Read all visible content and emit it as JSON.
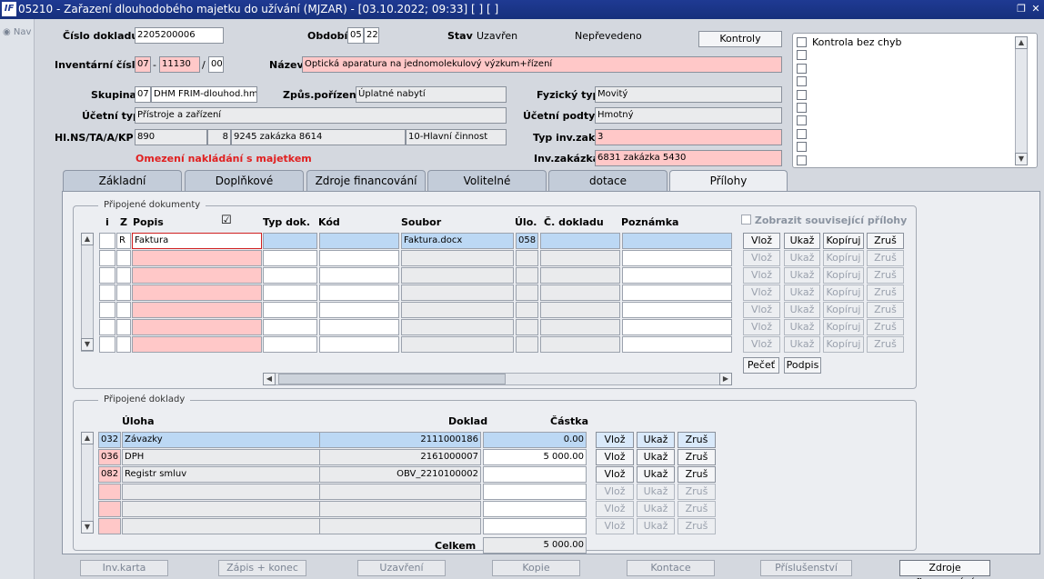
{
  "window": {
    "logo": "IF",
    "title": "05210 - Zařazení dlouhodobého majetku do užívání (MJZAR) - [03.10.2022; 09:33]  [ ]  [ ]"
  },
  "nav": {
    "label": "Nav"
  },
  "header": {
    "cislo_dokladu": {
      "label": "Číslo dokladu",
      "value": "2205200006"
    },
    "obdobi": {
      "label": "Období",
      "month": "05",
      "year": "22"
    },
    "stav": {
      "label": "Stav",
      "value": "Uzavřen",
      "transfer": "Nepřevedeno"
    },
    "kontroly_btn": "Kontroly",
    "inv_cislo": {
      "label": "Inventární číslo",
      "a": "07",
      "sep1": "-",
      "b": "11130",
      "sep2": "/",
      "c": "00"
    },
    "nazev": {
      "label": "Název",
      "value": "Optická aparatura na jednomolekulový výzkum+řízení"
    },
    "skupina": {
      "label": "Skupina",
      "code": "07",
      "value": "DHM FRIM-dlouhod.hmo"
    },
    "zpusob": {
      "label": "Způs.pořízení",
      "value": "Úplatné nabytí"
    },
    "fyzicky": {
      "label": "Fyzický typ",
      "value": "Movitý"
    },
    "ucetni_typ": {
      "label": "Účetní typ",
      "value": "Přístroje a zařízení"
    },
    "ucetni_podtyp": {
      "label": "Účetní podtyp",
      "value": "Hmotný"
    },
    "hlns": {
      "label": "Hl.NS/TA/A/KP",
      "ns": "890",
      "ta": "8",
      "a": "9245 zakázka 8614",
      "kp": "10-Hlavní činnost"
    },
    "typ_inv": {
      "label": "Typ inv.zak.",
      "value": "3"
    },
    "omezeni": "Omezení nakládání s majetkem",
    "inv_zakazka": {
      "label": "Inv.zakázka",
      "value": "6831 zakázka 5430"
    }
  },
  "checks": {
    "items": [
      "Kontrola bez chyb",
      "",
      "",
      "",
      "",
      "",
      "",
      "",
      "",
      ""
    ]
  },
  "tabs": [
    "Základní",
    "Doplňkové",
    "Zdroje financování",
    "Volitelné",
    "dotace",
    "Přílohy"
  ],
  "docs": {
    "title": "Připojené dokumenty",
    "headers": {
      "i": "i",
      "z": "Z",
      "popis": "Popis",
      "typ": "Typ dok.",
      "kod": "Kód",
      "soubor": "Soubor",
      "ulo": "Úlo.",
      "cdok": "Č. dokladu",
      "pozn": "Poznámka"
    },
    "rows": [
      {
        "i": "",
        "z": "R",
        "popis": "Faktura",
        "typ": "",
        "kod": "",
        "soubor": "Faktura.docx",
        "ulo": "058",
        "cdok": "",
        "pozn": ""
      },
      {
        "i": "",
        "z": "",
        "popis": "",
        "typ": "",
        "kod": "",
        "soubor": "",
        "ulo": "",
        "cdok": "",
        "pozn": ""
      },
      {
        "i": "",
        "z": "",
        "popis": "",
        "typ": "",
        "kod": "",
        "soubor": "",
        "ulo": "",
        "cdok": "",
        "pozn": ""
      },
      {
        "i": "",
        "z": "",
        "popis": "",
        "typ": "",
        "kod": "",
        "soubor": "",
        "ulo": "",
        "cdok": "",
        "pozn": ""
      },
      {
        "i": "",
        "z": "",
        "popis": "",
        "typ": "",
        "kod": "",
        "soubor": "",
        "ulo": "",
        "cdok": "",
        "pozn": ""
      },
      {
        "i": "",
        "z": "",
        "popis": "",
        "typ": "",
        "kod": "",
        "soubor": "",
        "ulo": "",
        "cdok": "",
        "pozn": ""
      },
      {
        "i": "",
        "z": "",
        "popis": "",
        "typ": "",
        "kod": "",
        "soubor": "",
        "ulo": "",
        "cdok": "",
        "pozn": ""
      }
    ],
    "show_related": "Zobrazit související přílohy",
    "row_buttons": [
      "Vlož",
      "Ukaž",
      "Kopíruj",
      "Zruš"
    ],
    "pecet": "Pečeť",
    "podpis": "Podpis"
  },
  "linked": {
    "title": "Připojené doklady",
    "headers": {
      "uloha": "Úloha",
      "doklad": "Doklad",
      "castka": "Částka"
    },
    "rows": [
      {
        "code": "032",
        "name": "Závazky",
        "doklad": "2111000186",
        "castka": "0.00"
      },
      {
        "code": "036",
        "name": "DPH",
        "doklad": "2161000007",
        "castka": "5 000.00"
      },
      {
        "code": "082",
        "name": "Registr smluv",
        "doklad": "OBV_2210100002",
        "castka": ""
      },
      {
        "code": "",
        "name": "",
        "doklad": "",
        "castka": ""
      },
      {
        "code": "",
        "name": "",
        "doklad": "",
        "castka": ""
      },
      {
        "code": "",
        "name": "",
        "doklad": "",
        "castka": ""
      }
    ],
    "row_buttons": [
      "Vlož",
      "Ukaž",
      "Zruš"
    ],
    "celkem_label": "Celkem",
    "celkem": "5 000.00"
  },
  "footer": [
    "Inv.karta",
    "Zápis + konec",
    "Uzavření",
    "Kopie",
    "Kontace",
    "Příslušenství",
    "Zdroje financování"
  ]
}
